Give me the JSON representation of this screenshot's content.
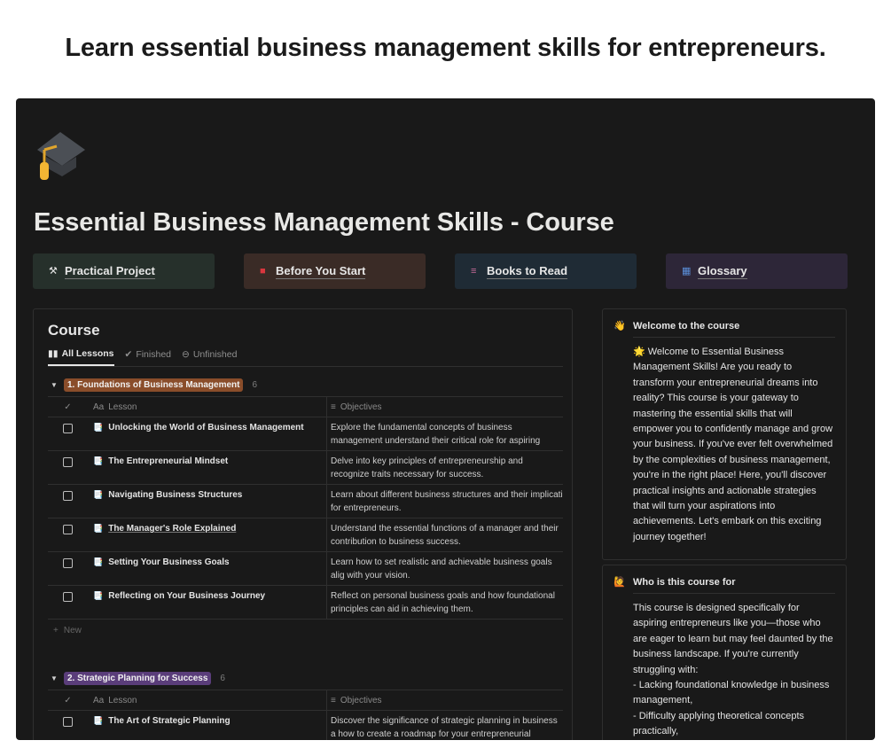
{
  "headline": "Learn essential business management skills for entrepreneurs.",
  "page": {
    "title": "Essential Business Management Skills - Course",
    "icon": "graduation-cap-icon"
  },
  "nav": [
    {
      "label": "Practical Project",
      "icon": "tools-icon",
      "bg": "#26302b"
    },
    {
      "label": "Before You Start",
      "icon": "book-icon",
      "bg": "#3a2b26"
    },
    {
      "label": "Books to Read",
      "icon": "books-icon",
      "bg": "#1f2b35"
    },
    {
      "label": "Glossary",
      "icon": "abc-icon",
      "bg": "#2d2638"
    }
  ],
  "database": {
    "title": "Course",
    "views": [
      "All Lessons",
      "Finished",
      "Unfinished"
    ],
    "column_lesson": "Lesson",
    "column_objectives": "Objectives",
    "new_label": "New",
    "groups": [
      {
        "name": "1. Foundations of Business Management",
        "count": "6",
        "color": "#8a4d2a",
        "rows": [
          {
            "lesson": "Unlocking the World of Business Management",
            "objective": "Explore the fundamental concepts of business management understand their critical role for aspiring entrepreneurs."
          },
          {
            "lesson": "The Entrepreneurial Mindset",
            "objective": "Delve into key principles of entrepreneurship and recognize traits necessary for success."
          },
          {
            "lesson": "Navigating Business Structures",
            "objective": "Learn about different business structures and their implicati for entrepreneurs."
          },
          {
            "lesson": "The Manager's Role Explained",
            "objective": "Understand the essential functions of a manager and their contribution to business success."
          },
          {
            "lesson": "Setting Your Business Goals",
            "objective": "Learn how to set realistic and achievable business goals alig with your vision."
          },
          {
            "lesson": "Reflecting on Your Business Journey",
            "objective": "Reflect on personal business goals and how foundational principles can aid in achieving them."
          }
        ]
      },
      {
        "name": "2. Strategic Planning for Success",
        "count": "6",
        "color": "#5a3d7a",
        "rows": [
          {
            "lesson": "The Art of Strategic Planning",
            "objective": "Discover the significance of strategic planning in business a how to create a roadmap for your entrepreneurial journey."
          }
        ]
      }
    ]
  },
  "cards": [
    {
      "title": "Welcome to the course",
      "icon": "waving-hand-icon",
      "body": "🌟 Welcome to Essential Business Management Skills! Are you ready to transform your entrepreneurial dreams into reality? This course is your gateway to mastering the essential skills that will empower you to confidently manage and grow your business. If you've ever felt overwhelmed by the complexities of business management, you're in the right place! Here, you'll discover practical insights and actionable strategies that will turn your aspirations into achievements. Let's embark on this exciting journey together!"
    },
    {
      "title": "Who is this course for",
      "icon": "person-raising-hand-icon",
      "body": "This course is designed specifically for aspiring entrepreneurs like you—those who are eager to learn but may feel daunted by the business landscape. If you're currently struggling with:\n- Lacking foundational knowledge in business management,\n- Difficulty applying theoretical concepts practically,"
    }
  ]
}
